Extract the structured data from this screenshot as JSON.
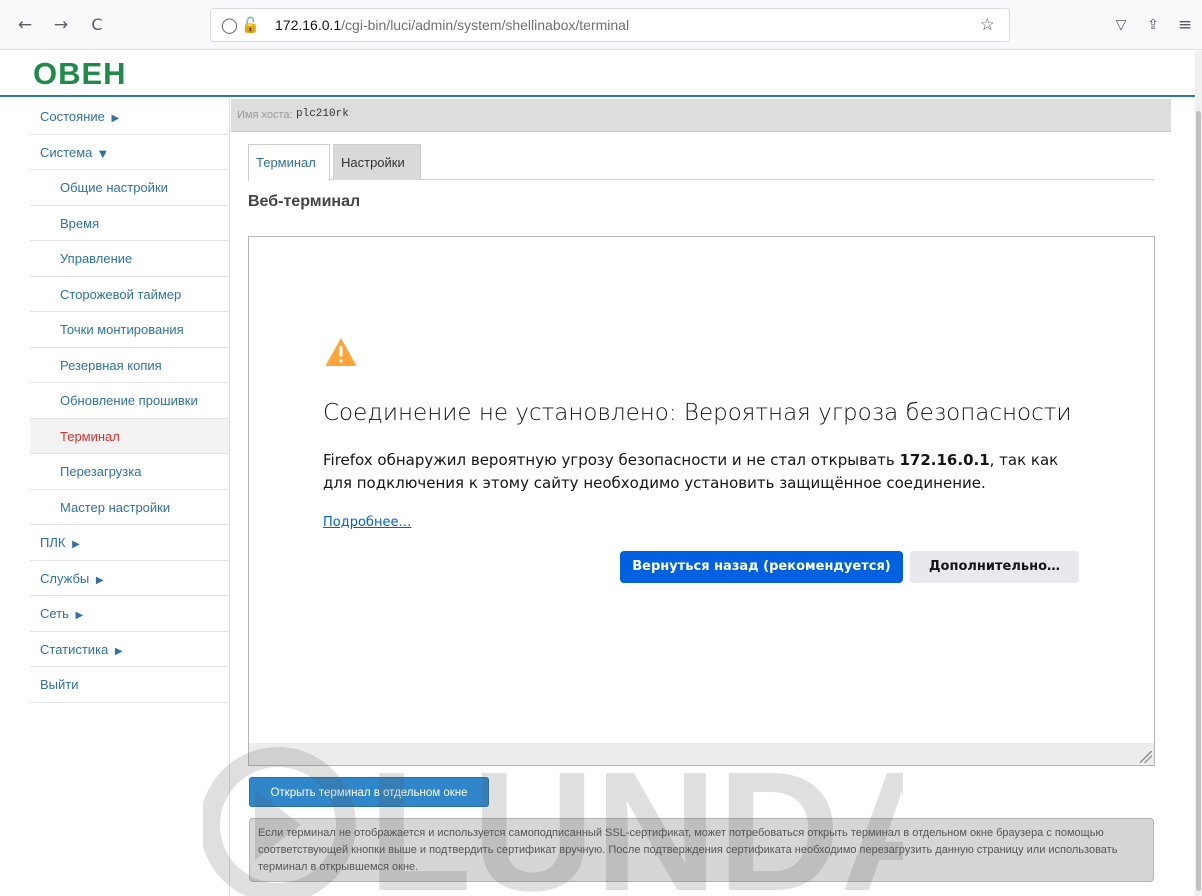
{
  "browser": {
    "back_icon": "←",
    "forward_icon": "→",
    "reload_icon": "C",
    "url_host": "172.16.0.1",
    "url_path": "/cgi-bin/luci/admin/system/shellinabox/terminal",
    "shield_icon": "◯",
    "lock_icon": "🔓",
    "star_icon": "☆",
    "pocket_icon": "▽",
    "extensions_icon": "⇪",
    "menu_icon": "≡"
  },
  "header": {
    "logo_text": "ОВЕН"
  },
  "sidebar": {
    "items": [
      {
        "label": "Состояние",
        "caret": "▶"
      },
      {
        "label": "Система",
        "caret": "▼"
      },
      {
        "label": "Общие настройки"
      },
      {
        "label": "Время"
      },
      {
        "label": "Управление"
      },
      {
        "label": "Сторожевой таймер"
      },
      {
        "label": "Точки монтирования"
      },
      {
        "label": "Резервная копия"
      },
      {
        "label": "Обновление прошивки"
      },
      {
        "label": "Терминал"
      },
      {
        "label": "Перезагрузка"
      },
      {
        "label": "Мастер настройки"
      },
      {
        "label": "ПЛК",
        "caret": "▶"
      },
      {
        "label": "Службы",
        "caret": "▶"
      },
      {
        "label": "Сеть",
        "caret": "▶"
      },
      {
        "label": "Статистика",
        "caret": "▶"
      },
      {
        "label": "Выйти"
      }
    ]
  },
  "hostbar": {
    "label": "Имя хоста:",
    "value": "plc210rk"
  },
  "tabs": [
    {
      "label": "Терминал"
    },
    {
      "label": "Настройки"
    }
  ],
  "section_title": "Веб-терминал",
  "error_page": {
    "title": "Соединение не установлено: Вероятная угроза безопасности",
    "text_before": "Firefox обнаружил вероятную угрозу безопасности и не стал открывать ",
    "text_host": "172.16.0.1",
    "text_after": ", так как для подключения к этому сайту необходимо установить защищённое соединение.",
    "learn_more": "Подробнее…",
    "back_button": "Вернуться назад (рекомендуется)",
    "advanced_button": "Дополнительно…"
  },
  "open_button": "Открыть терминал в отдельном окне",
  "note": "Если терминал не отображается и используется самоподписанный SSL-сертификат, может потребоваться открыть терминал в отдельном окне браузера с помощью соответствующей кнопки выше и подтвердить сертификат вручную. После подтверждения сертификата необходимо перезагрузить данную страницу или использовать терминал в открывшемся окне.",
  "watermark_text": "LUNDA",
  "colors": {
    "link": "#2f72a3",
    "active_item": "#d8322c",
    "firefox_primary": "#0061e0",
    "header_rule": "#2a7f9e",
    "logo": "#1e8b4b"
  }
}
